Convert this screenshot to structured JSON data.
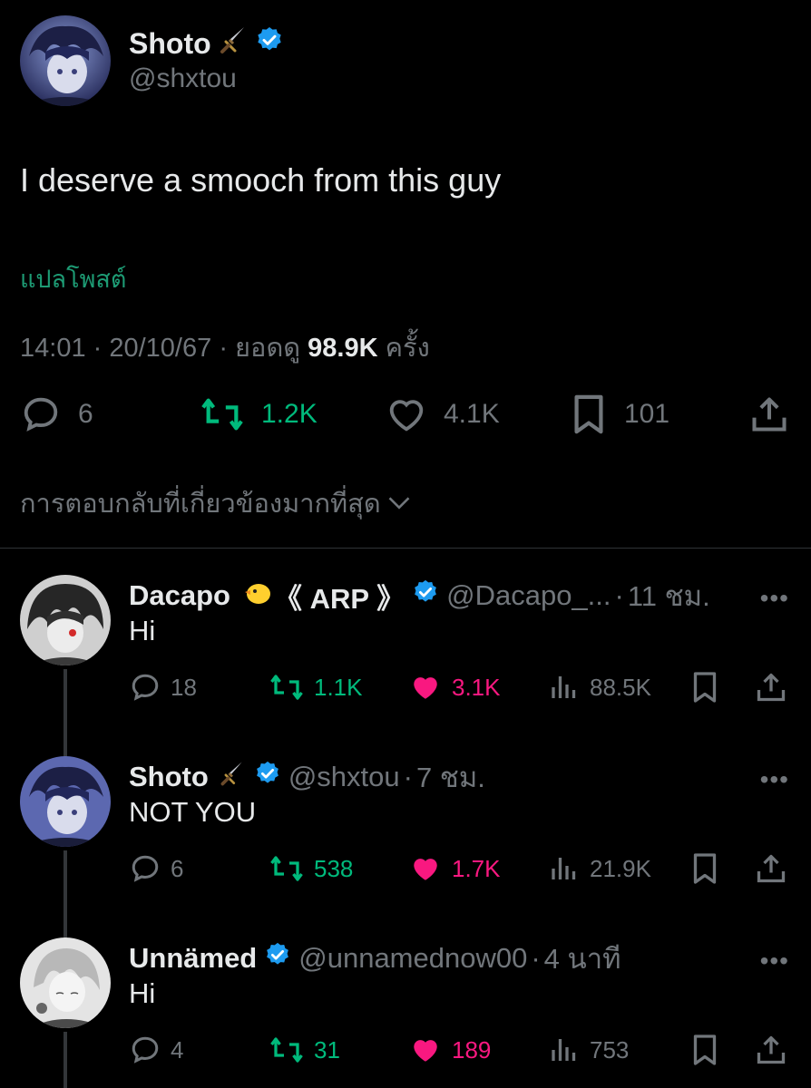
{
  "main_tweet": {
    "name": "Shoto",
    "name_emoji": "dagger",
    "handle": "@shxtou",
    "text": "I deserve a smooch from this guy",
    "translate": "แปลโพสต์",
    "time": "14:01",
    "date": "20/10/67",
    "views_prefix": "ยอดดู",
    "views": "98.9K",
    "views_suffix": "ครั้ง",
    "replies": "6",
    "reposts": "1.2K",
    "likes": "4.1K",
    "bookmarks": "101"
  },
  "sort_label": "การตอบกลับที่เกี่ยวข้องมากที่สุด",
  "replies": [
    {
      "name": "Dacapo",
      "name_extra": "《 ARP 》",
      "emoji": "chick",
      "handle": "@Dacapo_...",
      "time": "11 ชม.",
      "text": "Hi",
      "replies": "18",
      "reposts": "1.1K",
      "likes": "3.1K",
      "views": "88.5K",
      "liked": true
    },
    {
      "name": "Shoto",
      "emoji": "dagger",
      "handle": "@shxtou",
      "time": "7 ชม.",
      "text": "NOT YOU",
      "replies": "6",
      "reposts": "538",
      "likes": "1.7K",
      "views": "21.9K",
      "liked": true
    },
    {
      "name": "Unnämed",
      "handle": "@unnamednow00",
      "time": "4 นาที",
      "text": "Hi",
      "replies": "4",
      "reposts": "31",
      "likes": "189",
      "views": "753",
      "liked": true
    }
  ],
  "colors": {
    "background": "#000000",
    "text": "#e7e9ea",
    "muted": "#71767b",
    "repost_green": "#00ba7c",
    "translate_green": "#1d9b74",
    "like_pink": "#f91880",
    "verified_blue": "#1d9bf0"
  }
}
